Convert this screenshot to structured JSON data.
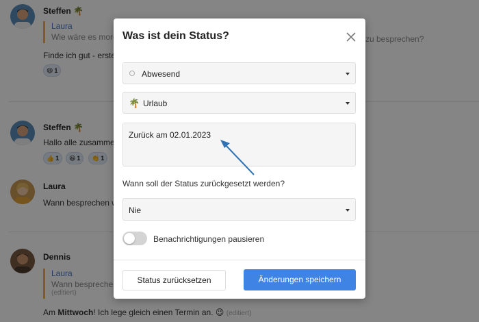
{
  "chat": {
    "msg1": {
      "author": "Steffen",
      "author_emoji": "🌴",
      "quote_author": "Laura",
      "quote_text_left": "Wie wäre es morg",
      "quote_text_right": "zu besprechen?",
      "text": "Finde ich gut - erste",
      "reactions": [
        {
          "icon": "happy-face-icon",
          "count": "1"
        }
      ]
    },
    "msg2": {
      "author": "Steffen",
      "author_emoji": "🌴",
      "text": "Hallo alle zusamme",
      "reactions": [
        {
          "icon": "thumbs-up-icon",
          "count": "1"
        },
        {
          "icon": "happy-face-icon",
          "count": "1"
        },
        {
          "icon": "clap-icon",
          "count": "1"
        }
      ]
    },
    "msg3": {
      "author": "Laura",
      "text": "Wann besprechen w"
    },
    "msg4": {
      "author": "Dennis",
      "quote_author": "Laura",
      "quote_text": "Wann besprechen",
      "quote_edited": "(editiert)",
      "text_pre": "Am ",
      "text_bold": "Mittwoch",
      "text_post": "! Ich lege gleich einen Termin an.",
      "edited": "(editiert)"
    }
  },
  "modal": {
    "title": "Was ist dein Status?",
    "presence": {
      "value": "Abwesend",
      "icon": "presence-circle-icon"
    },
    "status_type": {
      "value": "Urlaub",
      "icon": "palm-tree-icon"
    },
    "status_message": "Zurück am 02.01.2023",
    "reset_question": "Wann soll der Status zurückgesetzt werden?",
    "reset_value": "Nie",
    "pause_notifications_label": "Benachrichtigungen pausieren",
    "pause_notifications_on": false,
    "reset_button": "Status zurücksetzen",
    "save_button": "Änderungen speichern"
  },
  "colors": {
    "accent": "#3f84e5",
    "quote_border": "#f0b74a",
    "quote_author": "#4a78c2",
    "annotation_arrow": "#2e72b5"
  }
}
